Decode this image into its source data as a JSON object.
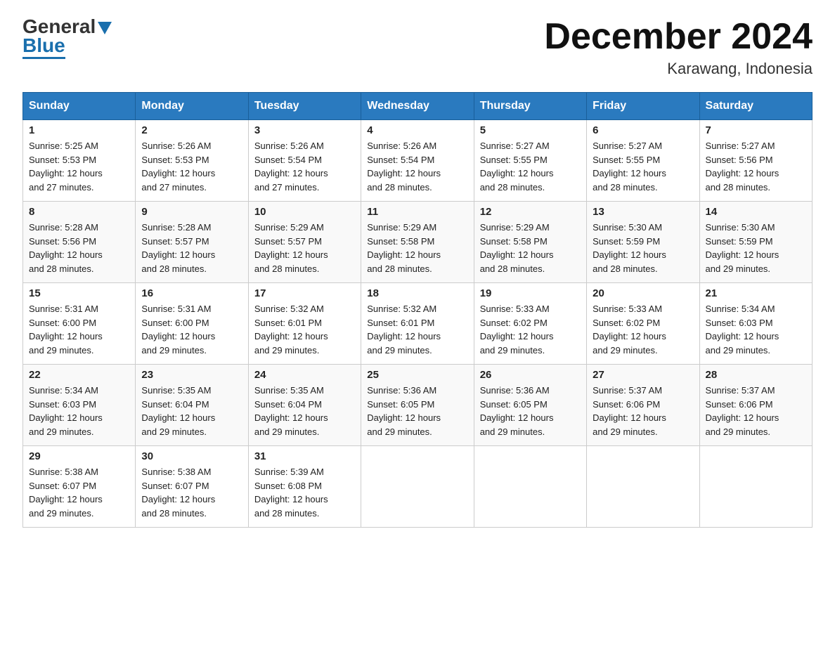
{
  "header": {
    "logo": {
      "general_text": "General",
      "blue_text": "Blue",
      "arrow_label": "logo-arrow"
    },
    "month_title": "December 2024",
    "subtitle": "Karawang, Indonesia"
  },
  "calendar": {
    "days_of_week": [
      "Sunday",
      "Monday",
      "Tuesday",
      "Wednesday",
      "Thursday",
      "Friday",
      "Saturday"
    ],
    "weeks": [
      [
        {
          "day": "1",
          "sunrise": "5:25 AM",
          "sunset": "5:53 PM",
          "daylight": "12 hours and 27 minutes."
        },
        {
          "day": "2",
          "sunrise": "5:26 AM",
          "sunset": "5:53 PM",
          "daylight": "12 hours and 27 minutes."
        },
        {
          "day": "3",
          "sunrise": "5:26 AM",
          "sunset": "5:54 PM",
          "daylight": "12 hours and 27 minutes."
        },
        {
          "day": "4",
          "sunrise": "5:26 AM",
          "sunset": "5:54 PM",
          "daylight": "12 hours and 28 minutes."
        },
        {
          "day": "5",
          "sunrise": "5:27 AM",
          "sunset": "5:55 PM",
          "daylight": "12 hours and 28 minutes."
        },
        {
          "day": "6",
          "sunrise": "5:27 AM",
          "sunset": "5:55 PM",
          "daylight": "12 hours and 28 minutes."
        },
        {
          "day": "7",
          "sunrise": "5:27 AM",
          "sunset": "5:56 PM",
          "daylight": "12 hours and 28 minutes."
        }
      ],
      [
        {
          "day": "8",
          "sunrise": "5:28 AM",
          "sunset": "5:56 PM",
          "daylight": "12 hours and 28 minutes."
        },
        {
          "day": "9",
          "sunrise": "5:28 AM",
          "sunset": "5:57 PM",
          "daylight": "12 hours and 28 minutes."
        },
        {
          "day": "10",
          "sunrise": "5:29 AM",
          "sunset": "5:57 PM",
          "daylight": "12 hours and 28 minutes."
        },
        {
          "day": "11",
          "sunrise": "5:29 AM",
          "sunset": "5:58 PM",
          "daylight": "12 hours and 28 minutes."
        },
        {
          "day": "12",
          "sunrise": "5:29 AM",
          "sunset": "5:58 PM",
          "daylight": "12 hours and 28 minutes."
        },
        {
          "day": "13",
          "sunrise": "5:30 AM",
          "sunset": "5:59 PM",
          "daylight": "12 hours and 28 minutes."
        },
        {
          "day": "14",
          "sunrise": "5:30 AM",
          "sunset": "5:59 PM",
          "daylight": "12 hours and 29 minutes."
        }
      ],
      [
        {
          "day": "15",
          "sunrise": "5:31 AM",
          "sunset": "6:00 PM",
          "daylight": "12 hours and 29 minutes."
        },
        {
          "day": "16",
          "sunrise": "5:31 AM",
          "sunset": "6:00 PM",
          "daylight": "12 hours and 29 minutes."
        },
        {
          "day": "17",
          "sunrise": "5:32 AM",
          "sunset": "6:01 PM",
          "daylight": "12 hours and 29 minutes."
        },
        {
          "day": "18",
          "sunrise": "5:32 AM",
          "sunset": "6:01 PM",
          "daylight": "12 hours and 29 minutes."
        },
        {
          "day": "19",
          "sunrise": "5:33 AM",
          "sunset": "6:02 PM",
          "daylight": "12 hours and 29 minutes."
        },
        {
          "day": "20",
          "sunrise": "5:33 AM",
          "sunset": "6:02 PM",
          "daylight": "12 hours and 29 minutes."
        },
        {
          "day": "21",
          "sunrise": "5:34 AM",
          "sunset": "6:03 PM",
          "daylight": "12 hours and 29 minutes."
        }
      ],
      [
        {
          "day": "22",
          "sunrise": "5:34 AM",
          "sunset": "6:03 PM",
          "daylight": "12 hours and 29 minutes."
        },
        {
          "day": "23",
          "sunrise": "5:35 AM",
          "sunset": "6:04 PM",
          "daylight": "12 hours and 29 minutes."
        },
        {
          "day": "24",
          "sunrise": "5:35 AM",
          "sunset": "6:04 PM",
          "daylight": "12 hours and 29 minutes."
        },
        {
          "day": "25",
          "sunrise": "5:36 AM",
          "sunset": "6:05 PM",
          "daylight": "12 hours and 29 minutes."
        },
        {
          "day": "26",
          "sunrise": "5:36 AM",
          "sunset": "6:05 PM",
          "daylight": "12 hours and 29 minutes."
        },
        {
          "day": "27",
          "sunrise": "5:37 AM",
          "sunset": "6:06 PM",
          "daylight": "12 hours and 29 minutes."
        },
        {
          "day": "28",
          "sunrise": "5:37 AM",
          "sunset": "6:06 PM",
          "daylight": "12 hours and 29 minutes."
        }
      ],
      [
        {
          "day": "29",
          "sunrise": "5:38 AM",
          "sunset": "6:07 PM",
          "daylight": "12 hours and 29 minutes."
        },
        {
          "day": "30",
          "sunrise": "5:38 AM",
          "sunset": "6:07 PM",
          "daylight": "12 hours and 28 minutes."
        },
        {
          "day": "31",
          "sunrise": "5:39 AM",
          "sunset": "6:08 PM",
          "daylight": "12 hours and 28 minutes."
        },
        {
          "day": "",
          "sunrise": "",
          "sunset": "",
          "daylight": ""
        },
        {
          "day": "",
          "sunrise": "",
          "sunset": "",
          "daylight": ""
        },
        {
          "day": "",
          "sunrise": "",
          "sunset": "",
          "daylight": ""
        },
        {
          "day": "",
          "sunrise": "",
          "sunset": "",
          "daylight": ""
        }
      ]
    ],
    "labels": {
      "sunrise_prefix": "Sunrise: ",
      "sunset_prefix": "Sunset: ",
      "daylight_prefix": "Daylight: "
    }
  }
}
